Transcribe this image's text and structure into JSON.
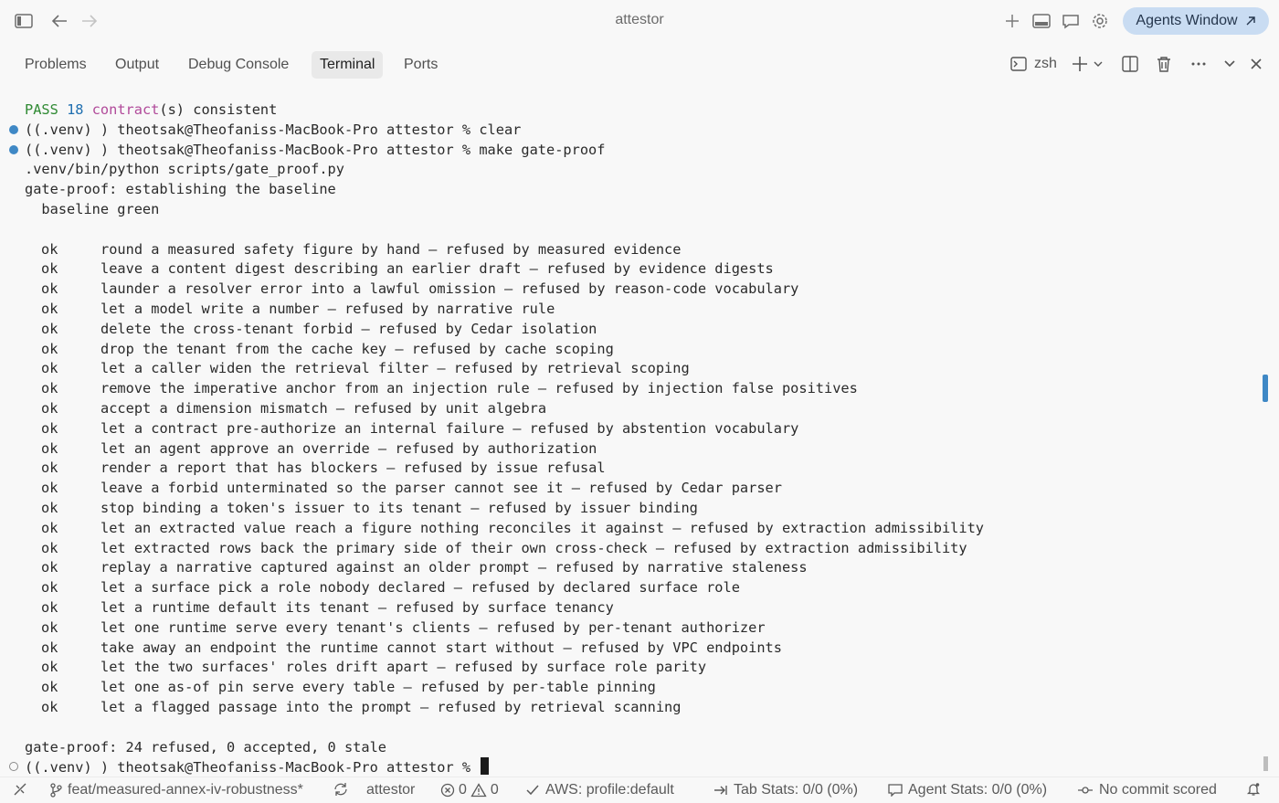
{
  "window": {
    "title": "attestor"
  },
  "titlebar": {
    "agents_button": "Agents Window"
  },
  "panel": {
    "tabs": [
      {
        "label": "Problems"
      },
      {
        "label": "Output"
      },
      {
        "label": "Debug Console"
      },
      {
        "label": "Terminal",
        "active": true
      },
      {
        "label": "Ports"
      }
    ],
    "shell_label": "zsh"
  },
  "terminal": {
    "pass_line": {
      "status": "PASS",
      "count": "18",
      "kw": "contract",
      "rest": "(s) consistent"
    },
    "prompt_clear": "((.venv) ) theotsak@Theofaniss-MacBook-Pro attestor % clear",
    "prompt_make": "((.venv) ) theotsak@Theofaniss-MacBook-Pro attestor % make gate-proof",
    "cmd_line": ".venv/bin/python scripts/gate_proof.py",
    "gate_start": "gate-proof: establishing the baseline",
    "baseline": "  baseline green",
    "results": [
      {
        "status": "ok",
        "text": "round a measured safety figure by hand — refused by measured evidence"
      },
      {
        "status": "ok",
        "text": "leave a content digest describing an earlier draft — refused by evidence digests"
      },
      {
        "status": "ok",
        "text": "launder a resolver error into a lawful omission — refused by reason-code vocabulary"
      },
      {
        "status": "ok",
        "text": "let a model write a number — refused by narrative rule"
      },
      {
        "status": "ok",
        "text": "delete the cross-tenant forbid — refused by Cedar isolation"
      },
      {
        "status": "ok",
        "text": "drop the tenant from the cache key — refused by cache scoping"
      },
      {
        "status": "ok",
        "text": "let a caller widen the retrieval filter — refused by retrieval scoping"
      },
      {
        "status": "ok",
        "text": "remove the imperative anchor from an injection rule — refused by injection false positives"
      },
      {
        "status": "ok",
        "text": "accept a dimension mismatch — refused by unit algebra"
      },
      {
        "status": "ok",
        "text": "let a contract pre-authorize an internal failure — refused by abstention vocabulary"
      },
      {
        "status": "ok",
        "text": "let an agent approve an override — refused by authorization"
      },
      {
        "status": "ok",
        "text": "render a report that has blockers — refused by issue refusal"
      },
      {
        "status": "ok",
        "text": "leave a forbid unterminated so the parser cannot see it — refused by Cedar parser"
      },
      {
        "status": "ok",
        "text": "stop binding a token's issuer to its tenant — refused by issuer binding"
      },
      {
        "status": "ok",
        "text": "let an extracted value reach a figure nothing reconciles it against — refused by extraction admissibility"
      },
      {
        "status": "ok",
        "text": "let extracted rows back the primary side of their own cross-check — refused by extraction admissibility"
      },
      {
        "status": "ok",
        "text": "replay a narrative captured against an older prompt — refused by narrative staleness"
      },
      {
        "status": "ok",
        "text": "let a surface pick a role nobody declared — refused by declared surface role"
      },
      {
        "status": "ok",
        "text": "let a runtime default its tenant — refused by surface tenancy"
      },
      {
        "status": "ok",
        "text": "let one runtime serve every tenant's clients — refused by per-tenant authorizer"
      },
      {
        "status": "ok",
        "text": "take away an endpoint the runtime cannot start without — refused by VPC endpoints"
      },
      {
        "status": "ok",
        "text": "let the two surfaces' roles drift apart — refused by surface role parity"
      },
      {
        "status": "ok",
        "text": "let one as-of pin serve every table — refused by per-table pinning"
      },
      {
        "status": "ok",
        "text": "let a flagged passage into the prompt — refused by retrieval scanning"
      }
    ],
    "summary": "gate-proof: 24 refused, 0 accepted, 0 stale",
    "prompt_final": "((.venv) ) theotsak@Theofaniss-MacBook-Pro attestor % "
  },
  "statusbar": {
    "branch": "feat/measured-annex-iv-robustness*",
    "project": "attestor",
    "errors": "0",
    "warnings": "0",
    "aws": "AWS: profile:default",
    "tab_stats": "Tab Stats: 0/0 (0%)",
    "agent_stats": "Agent Stats: 0/0 (0%)",
    "commit": "No commit scored"
  }
}
